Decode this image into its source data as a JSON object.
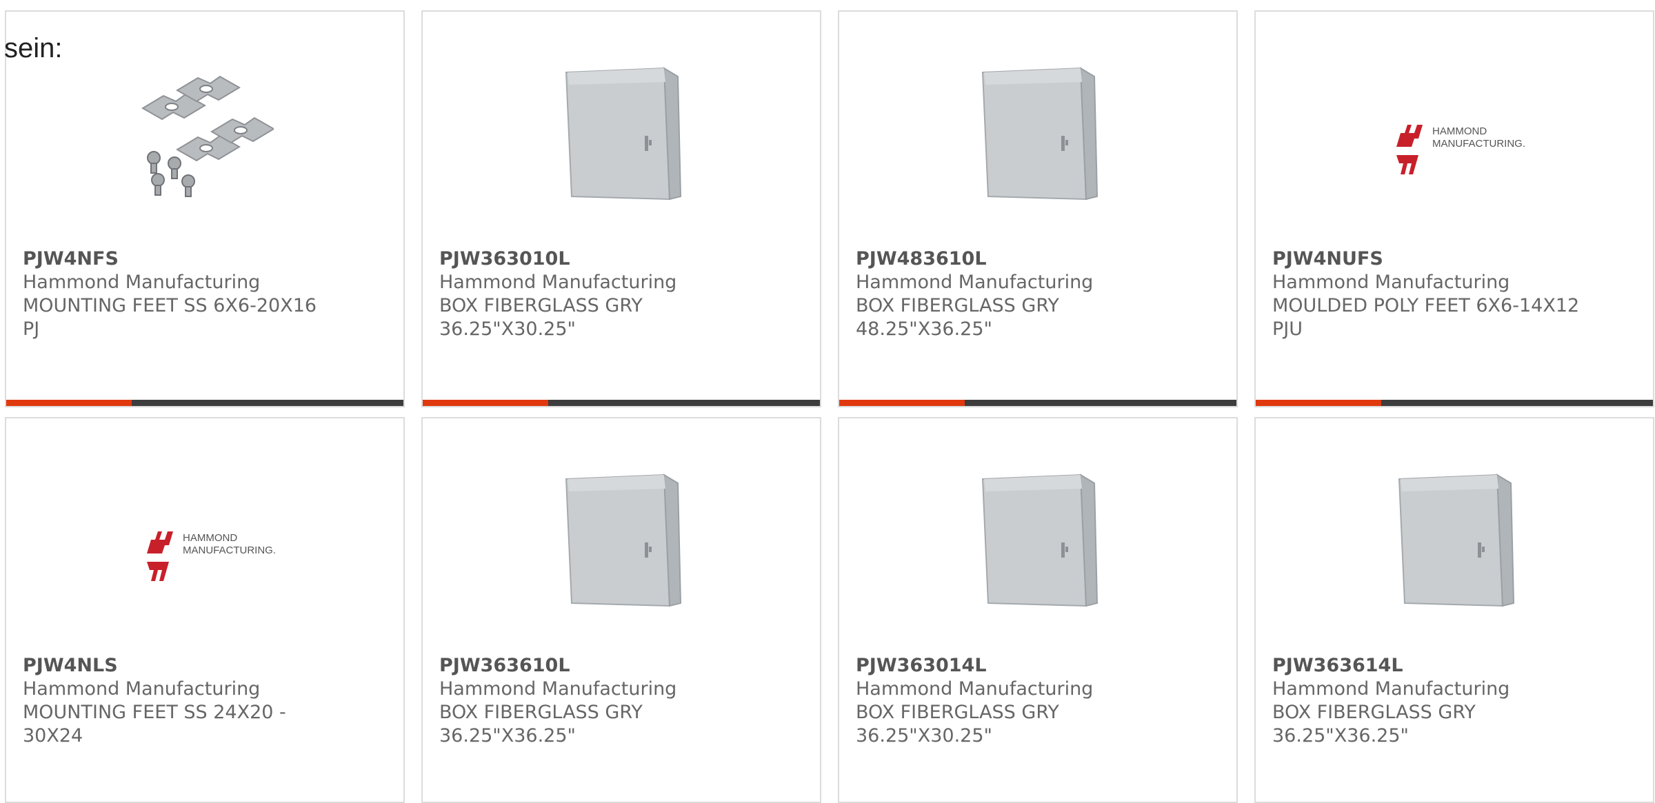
{
  "intro_text": "sein:",
  "colors": {
    "accent": "#e0390f",
    "bar_dark": "#3d3d3d",
    "brand_red": "#c8202a"
  },
  "products": [
    {
      "part_number": "PJW4NFS",
      "manufacturer": "Hammond Manufacturing",
      "desc_line1": "MOUNTING FEET SS 6X6-20X16",
      "desc_line2": "PJ",
      "image": "mounting-feet-icon"
    },
    {
      "part_number": "PJW363010L",
      "manufacturer": "Hammond Manufacturing",
      "desc_line1": "BOX FIBERGLASS GRY",
      "desc_line2": "36.25\"X30.25\"",
      "image": "enclosure-icon"
    },
    {
      "part_number": "PJW483610L",
      "manufacturer": "Hammond Manufacturing",
      "desc_line1": "BOX FIBERGLASS GRY",
      "desc_line2": "48.25\"X36.25\"",
      "image": "enclosure-icon"
    },
    {
      "part_number": "PJW4NUFS",
      "manufacturer": "Hammond Manufacturing",
      "desc_line1": "MOULDED POLY FEET 6X6-14X12",
      "desc_line2": "PJU",
      "image": "hammond-logo-icon"
    },
    {
      "part_number": "PJW4NLS",
      "manufacturer": "Hammond Manufacturing",
      "desc_line1": "MOUNTING FEET SS 24X20 -",
      "desc_line2": "30X24",
      "image": "hammond-logo-icon"
    },
    {
      "part_number": "PJW363610L",
      "manufacturer": "Hammond Manufacturing",
      "desc_line1": "BOX FIBERGLASS GRY",
      "desc_line2": "36.25\"X36.25\"",
      "image": "enclosure-icon"
    },
    {
      "part_number": "PJW363014L",
      "manufacturer": "Hammond Manufacturing",
      "desc_line1": "BOX FIBERGLASS GRY",
      "desc_line2": "36.25\"X30.25\"",
      "image": "enclosure-icon"
    },
    {
      "part_number": "PJW363614L",
      "manufacturer": "Hammond Manufacturing",
      "desc_line1": "BOX FIBERGLASS GRY",
      "desc_line2": "36.25\"X36.25\"",
      "image": "enclosure-icon"
    }
  ],
  "logo_text": {
    "line1": "HAMMOND",
    "line2": "MANUFACTURING."
  }
}
